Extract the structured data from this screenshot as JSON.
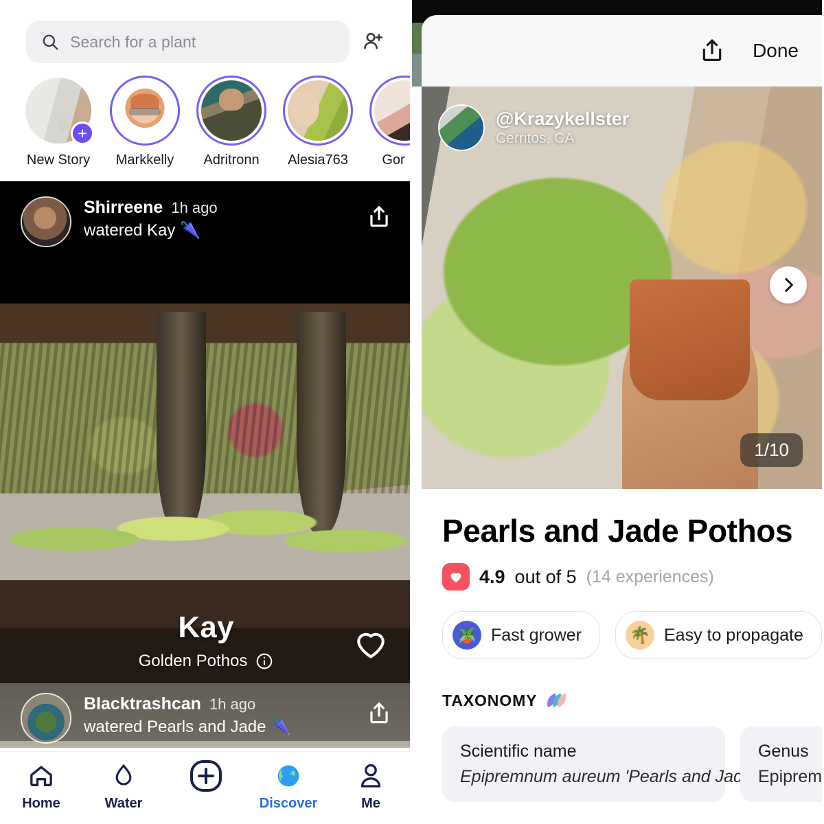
{
  "left": {
    "search": {
      "placeholder": "Search for a plant",
      "icon": "search-icon"
    },
    "add_friend_icon": "person-add-icon",
    "stories": [
      {
        "name": "New Story",
        "ring": false,
        "badge": "+",
        "avatar_class": "img-room"
      },
      {
        "name": "Markkelly",
        "ring": true,
        "avatar_class": "img-memoji"
      },
      {
        "name": "Adritronn",
        "ring": true,
        "avatar_class": "img-selfie1"
      },
      {
        "name": "Alesia763",
        "ring": true,
        "avatar_class": "img-shrek"
      },
      {
        "name": "Gor",
        "ring": true,
        "avatar_class": "img-gor"
      }
    ],
    "post1": {
      "user": "Shirreene",
      "time": "1h ago",
      "action": "watered Kay 🌂",
      "share_icon": "share-icon",
      "plant_name": "Kay",
      "plant_species": "Golden Pothos",
      "info_icon": "info-icon",
      "like_icon": "heart-icon"
    },
    "post2": {
      "user": "Blacktrashcan",
      "time": "1h ago",
      "action": "watered Pearls and Jade 🌂",
      "share_icon": "share-icon"
    },
    "tabs": [
      {
        "label": "Home",
        "icon": "home-icon",
        "active": false
      },
      {
        "label": "Water",
        "icon": "water-drop-icon",
        "active": false
      },
      {
        "label": "",
        "icon": "plus-circle-icon",
        "active": false
      },
      {
        "label": "Discover",
        "icon": "globe-icon",
        "active": true
      },
      {
        "label": "Me",
        "icon": "person-icon",
        "active": false
      }
    ]
  },
  "right": {
    "sheet": {
      "share_icon": "share-icon",
      "done_label": "Done"
    },
    "hero": {
      "handle": "@Krazykellster",
      "location": "Cerritos, CA",
      "next_icon": "chevron-right-icon",
      "counter": "1/10"
    },
    "detail": {
      "title": "Pearls and Jade Pothos",
      "rating_icon": "heart-badge-icon",
      "rating_score": "4.9",
      "rating_outof": "out of 5",
      "rating_count": "(14 experiences)",
      "chips": [
        {
          "label": "Fast grower",
          "emoji": "🪴",
          "bg": "#4a5ad6"
        },
        {
          "label": "Easy to propagate",
          "emoji": "🌴",
          "bg": "#f7d199"
        }
      ],
      "taxonomy_heading": "TAXONOMY",
      "taxonomy_icon": "leaf-stack-icon",
      "taxonomy_cards": [
        {
          "label": "Scientific name",
          "value": "Epipremnum aureum 'Pearls and Jade'",
          "italic": true
        },
        {
          "label": "Genus",
          "value": "Epipremnum",
          "italic": false
        }
      ]
    }
  },
  "colors": {
    "story_ring": "#7c5cf5",
    "plus_badge": "#6d4df0",
    "accent_blue": "#2a6fd4",
    "nav_navy": "#1a1f4d",
    "rating_red": "#f5525f"
  }
}
